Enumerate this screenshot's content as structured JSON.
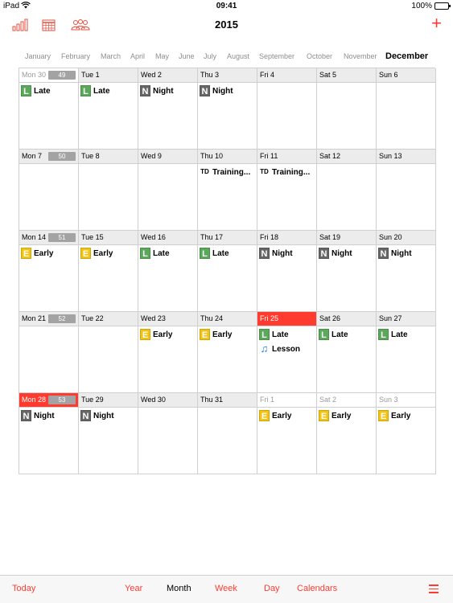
{
  "status": {
    "carrier": "iPad",
    "time": "09:41",
    "battery": "100%"
  },
  "nav": {
    "title": "2015",
    "left_icons": [
      "signal-bars-icon",
      "calendar-grid-icon",
      "people-icon"
    ],
    "add_label": "+"
  },
  "months": [
    "January",
    "February",
    "March",
    "April",
    "May",
    "June",
    "July",
    "August",
    "September",
    "October",
    "November",
    "December"
  ],
  "active_month": "December",
  "weeks": [
    {
      "days": [
        {
          "label": "Mon 30",
          "dim": true,
          "weeknum": "49",
          "events": [
            {
              "badge": "L",
              "text": "Late"
            }
          ]
        },
        {
          "label": "Tue 1",
          "events": [
            {
              "badge": "L",
              "text": "Late"
            }
          ]
        },
        {
          "label": "Wed 2",
          "events": [
            {
              "badge": "N",
              "text": "Night"
            }
          ]
        },
        {
          "label": "Thu 3",
          "events": [
            {
              "badge": "N",
              "text": "Night"
            }
          ]
        },
        {
          "label": "Fri 4",
          "events": []
        },
        {
          "label": "Sat 5",
          "events": []
        },
        {
          "label": "Sun 6",
          "events": []
        }
      ]
    },
    {
      "days": [
        {
          "label": "Mon 7",
          "weeknum": "50",
          "events": []
        },
        {
          "label": "Tue 8",
          "events": []
        },
        {
          "label": "Wed 9",
          "events": []
        },
        {
          "label": "Thu 10",
          "events": [
            {
              "badge": "TD",
              "text": "Training..."
            }
          ]
        },
        {
          "label": "Fri 11",
          "events": [
            {
              "badge": "TD",
              "text": "Training..."
            }
          ]
        },
        {
          "label": "Sat 12",
          "events": []
        },
        {
          "label": "Sun 13",
          "events": []
        }
      ]
    },
    {
      "days": [
        {
          "label": "Mon 14",
          "weeknum": "51",
          "events": [
            {
              "badge": "E",
              "text": "Early"
            }
          ]
        },
        {
          "label": "Tue 15",
          "events": [
            {
              "badge": "E",
              "text": "Early"
            }
          ]
        },
        {
          "label": "Wed 16",
          "events": [
            {
              "badge": "L",
              "text": "Late"
            }
          ]
        },
        {
          "label": "Thu 17",
          "events": [
            {
              "badge": "L",
              "text": "Late"
            }
          ]
        },
        {
          "label": "Fri 18",
          "events": [
            {
              "badge": "N",
              "text": "Night"
            }
          ]
        },
        {
          "label": "Sat 19",
          "events": [
            {
              "badge": "N",
              "text": "Night"
            }
          ]
        },
        {
          "label": "Sun 20",
          "events": [
            {
              "badge": "N",
              "text": "Night"
            }
          ]
        }
      ]
    },
    {
      "days": [
        {
          "label": "Mon 21",
          "weeknum": "52",
          "events": []
        },
        {
          "label": "Tue 22",
          "events": []
        },
        {
          "label": "Wed 23",
          "events": [
            {
              "badge": "E",
              "text": "Early"
            }
          ]
        },
        {
          "label": "Thu 24",
          "events": [
            {
              "badge": "E",
              "text": "Early"
            }
          ]
        },
        {
          "label": "Fri 25",
          "highlight": true,
          "events": [
            {
              "badge": "L",
              "text": "Late"
            },
            {
              "badge": "note",
              "text": "Lesson"
            }
          ]
        },
        {
          "label": "Sat 26",
          "events": [
            {
              "badge": "L",
              "text": "Late"
            }
          ]
        },
        {
          "label": "Sun 27",
          "events": [
            {
              "badge": "L",
              "text": "Late"
            }
          ]
        }
      ]
    },
    {
      "days": [
        {
          "label": "Mon 28",
          "highlight": true,
          "weeknum": "53",
          "events": [
            {
              "badge": "N",
              "text": "Night"
            }
          ]
        },
        {
          "label": "Tue 29",
          "events": [
            {
              "badge": "N",
              "text": "Night"
            }
          ]
        },
        {
          "label": "Wed 30",
          "events": []
        },
        {
          "label": "Thu 31",
          "events": []
        },
        {
          "label": "Fri 1",
          "dim": true,
          "events": [
            {
              "badge": "E",
              "text": "Early"
            }
          ]
        },
        {
          "label": "Sat 2",
          "dim": true,
          "events": [
            {
              "badge": "E",
              "text": "Early"
            }
          ]
        },
        {
          "label": "Sun 3",
          "dim": true,
          "events": [
            {
              "badge": "E",
              "text": "Early"
            }
          ]
        }
      ]
    }
  ],
  "tabbar": {
    "today": "Today",
    "year": "Year",
    "month": "Month",
    "week": "Week",
    "day": "Day",
    "calendars": "Calendars",
    "menu_icon": "hamburger-menu-icon"
  },
  "colors": {
    "accent": "#ff3b30",
    "late": "#5aa85a",
    "night": "#666666",
    "early": "#f2c313"
  }
}
